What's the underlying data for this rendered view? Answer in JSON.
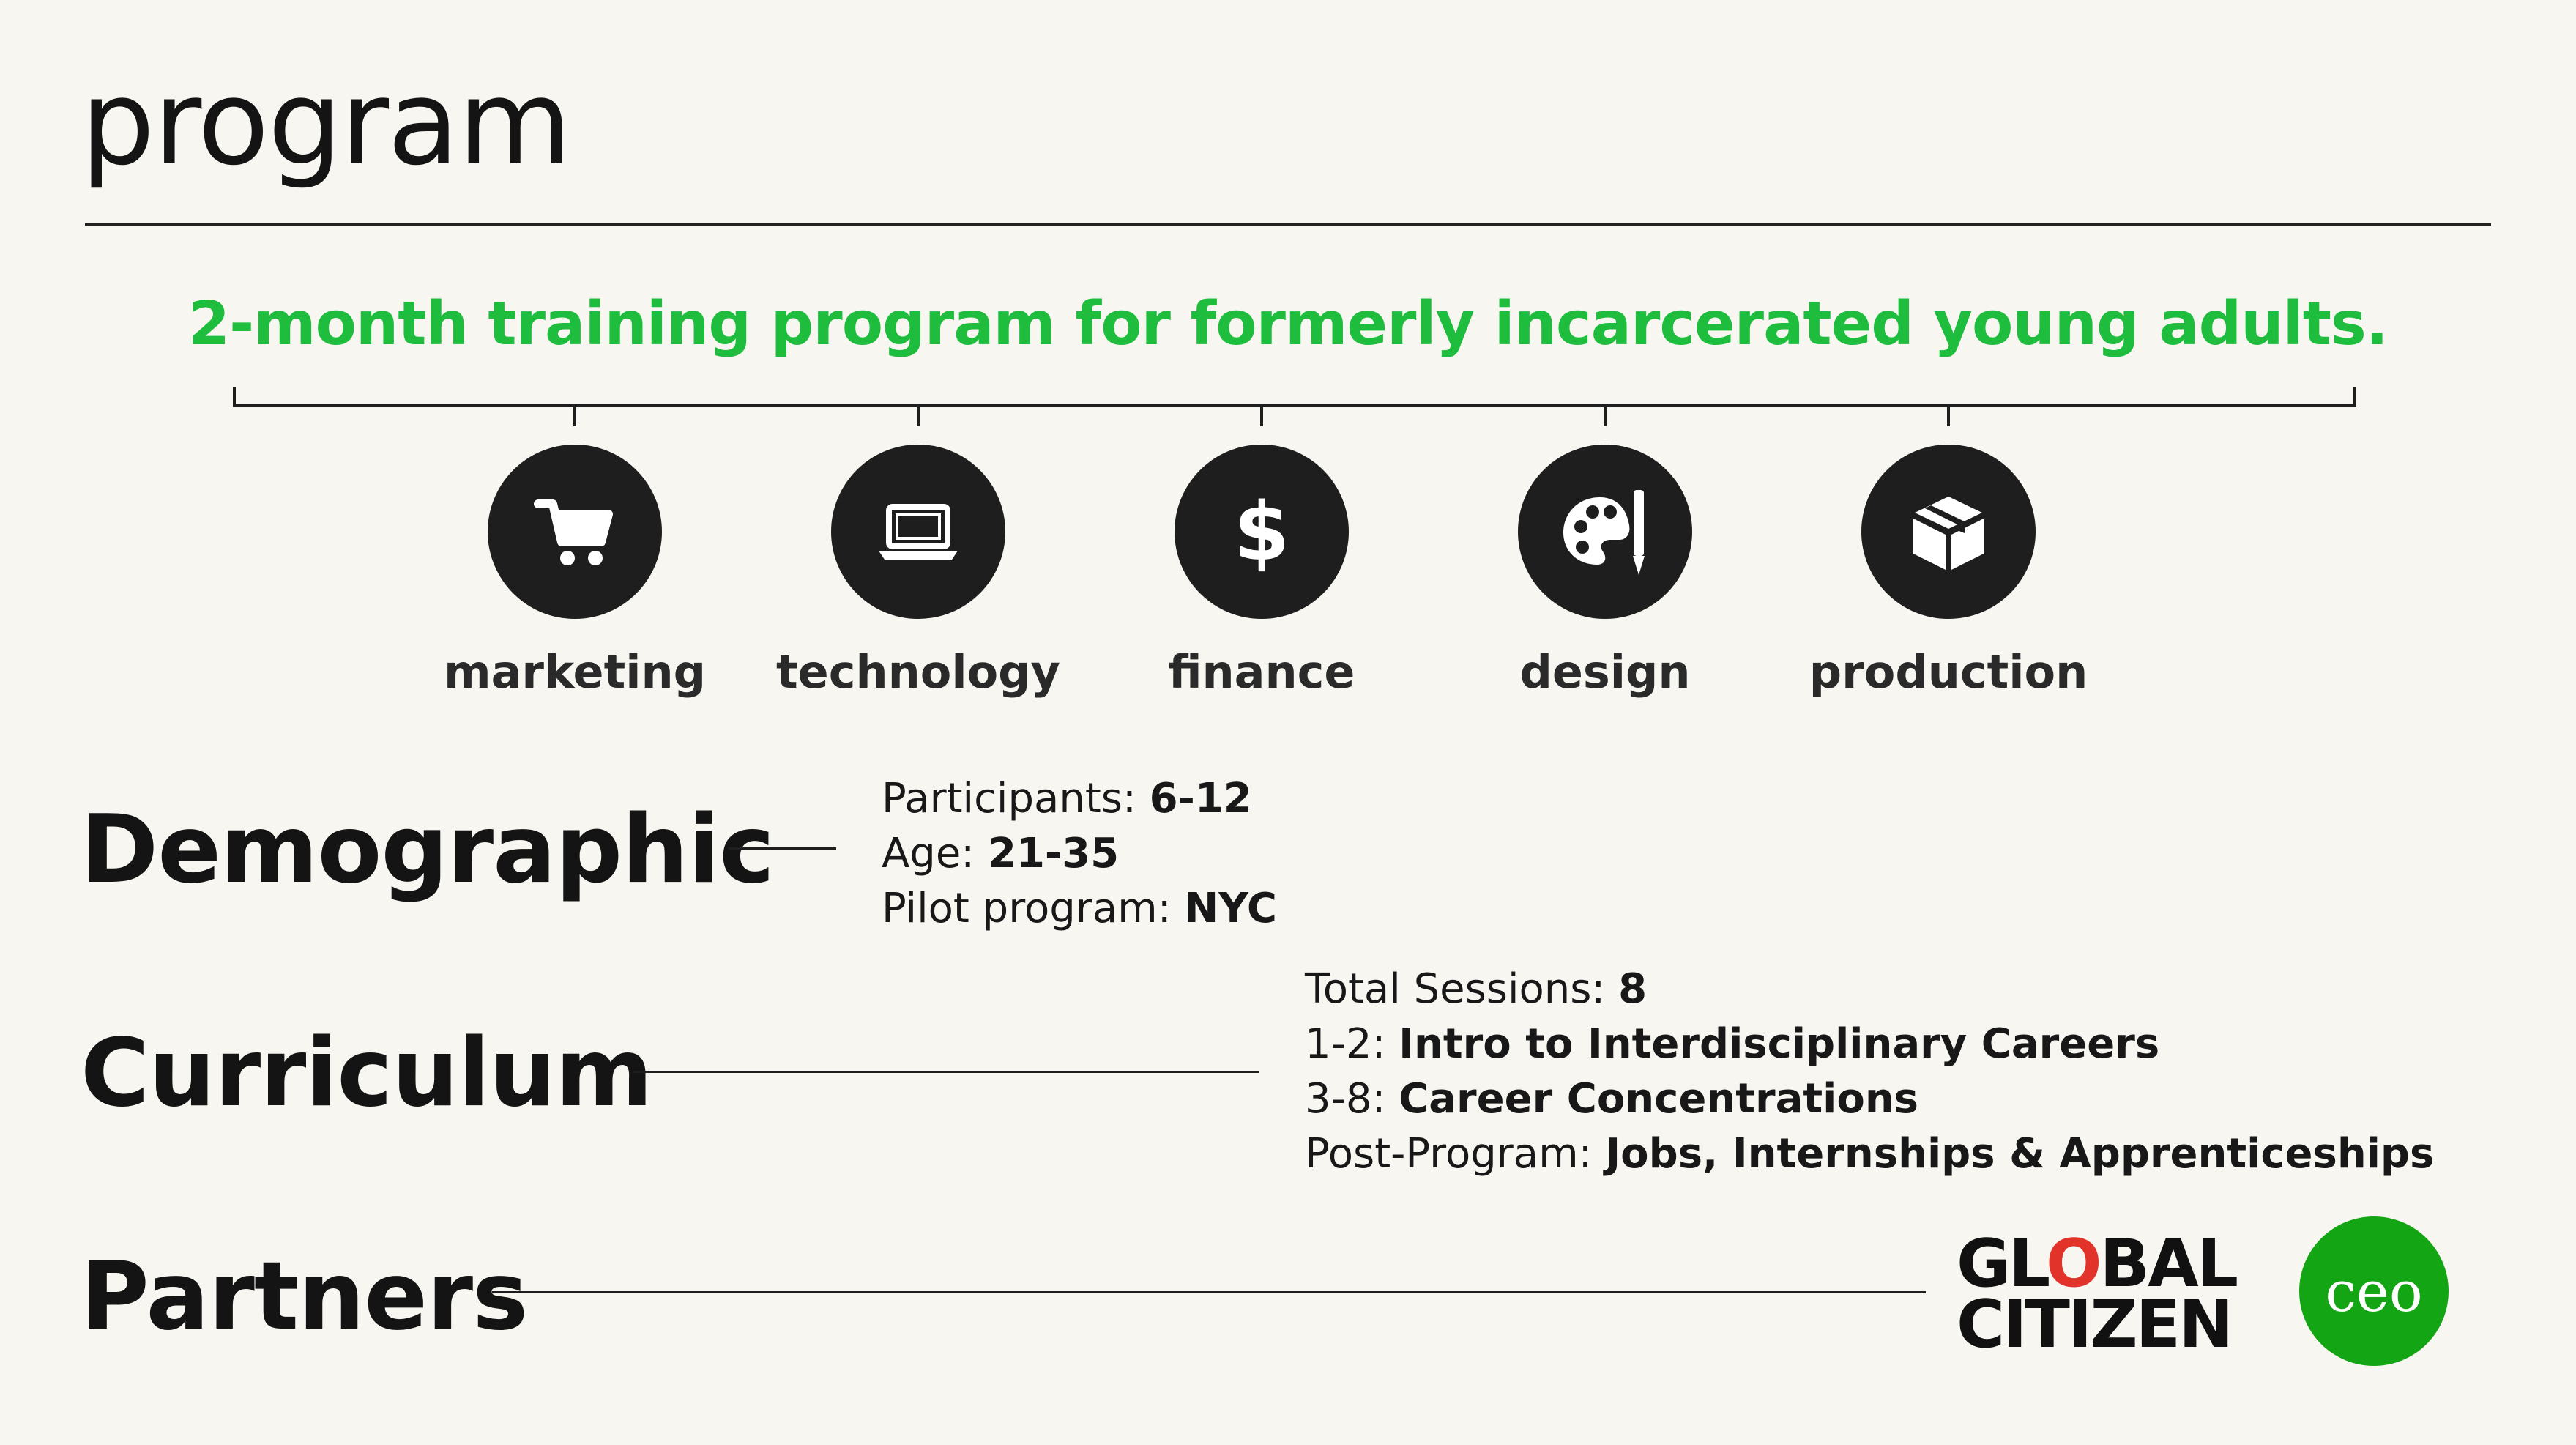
{
  "page": {
    "title": "program"
  },
  "tagline": "2-month training program for formerly incarcerated young adults.",
  "categories": [
    {
      "label": "marketing",
      "icon": "shopping-cart-icon"
    },
    {
      "label": "technology",
      "icon": "laptop-icon"
    },
    {
      "label": "finance",
      "icon": "dollar-icon"
    },
    {
      "label": "design",
      "icon": "palette-icon"
    },
    {
      "label": "production",
      "icon": "box-icon"
    }
  ],
  "demographic": {
    "heading": "Demographic",
    "lines": [
      {
        "label": "Participants: ",
        "value": "6-12"
      },
      {
        "label": "Age: ",
        "value": "21-35"
      },
      {
        "label": "Pilot program: ",
        "value": "NYC"
      }
    ]
  },
  "curriculum": {
    "heading": "Curriculum",
    "lines": [
      {
        "label": "Total Sessions: ",
        "value": "8"
      },
      {
        "label": "1-2: ",
        "value": "Intro to Interdisciplinary Careers"
      },
      {
        "label": "3-8: ",
        "value": "Career Concentrations"
      },
      {
        "label": "Post-Program: ",
        "value": "Jobs, Internships & Apprenticeships"
      }
    ]
  },
  "partners": {
    "heading": "Partners",
    "global_citizen": {
      "line1": "GLOBAL",
      "line2": "CITIZEN"
    },
    "ceo": "ceo"
  },
  "colors": {
    "accent": "#1fbd3d",
    "dark": "#1e1e1e",
    "ceo_green": "#14a514",
    "global_o": "#e2332b"
  }
}
